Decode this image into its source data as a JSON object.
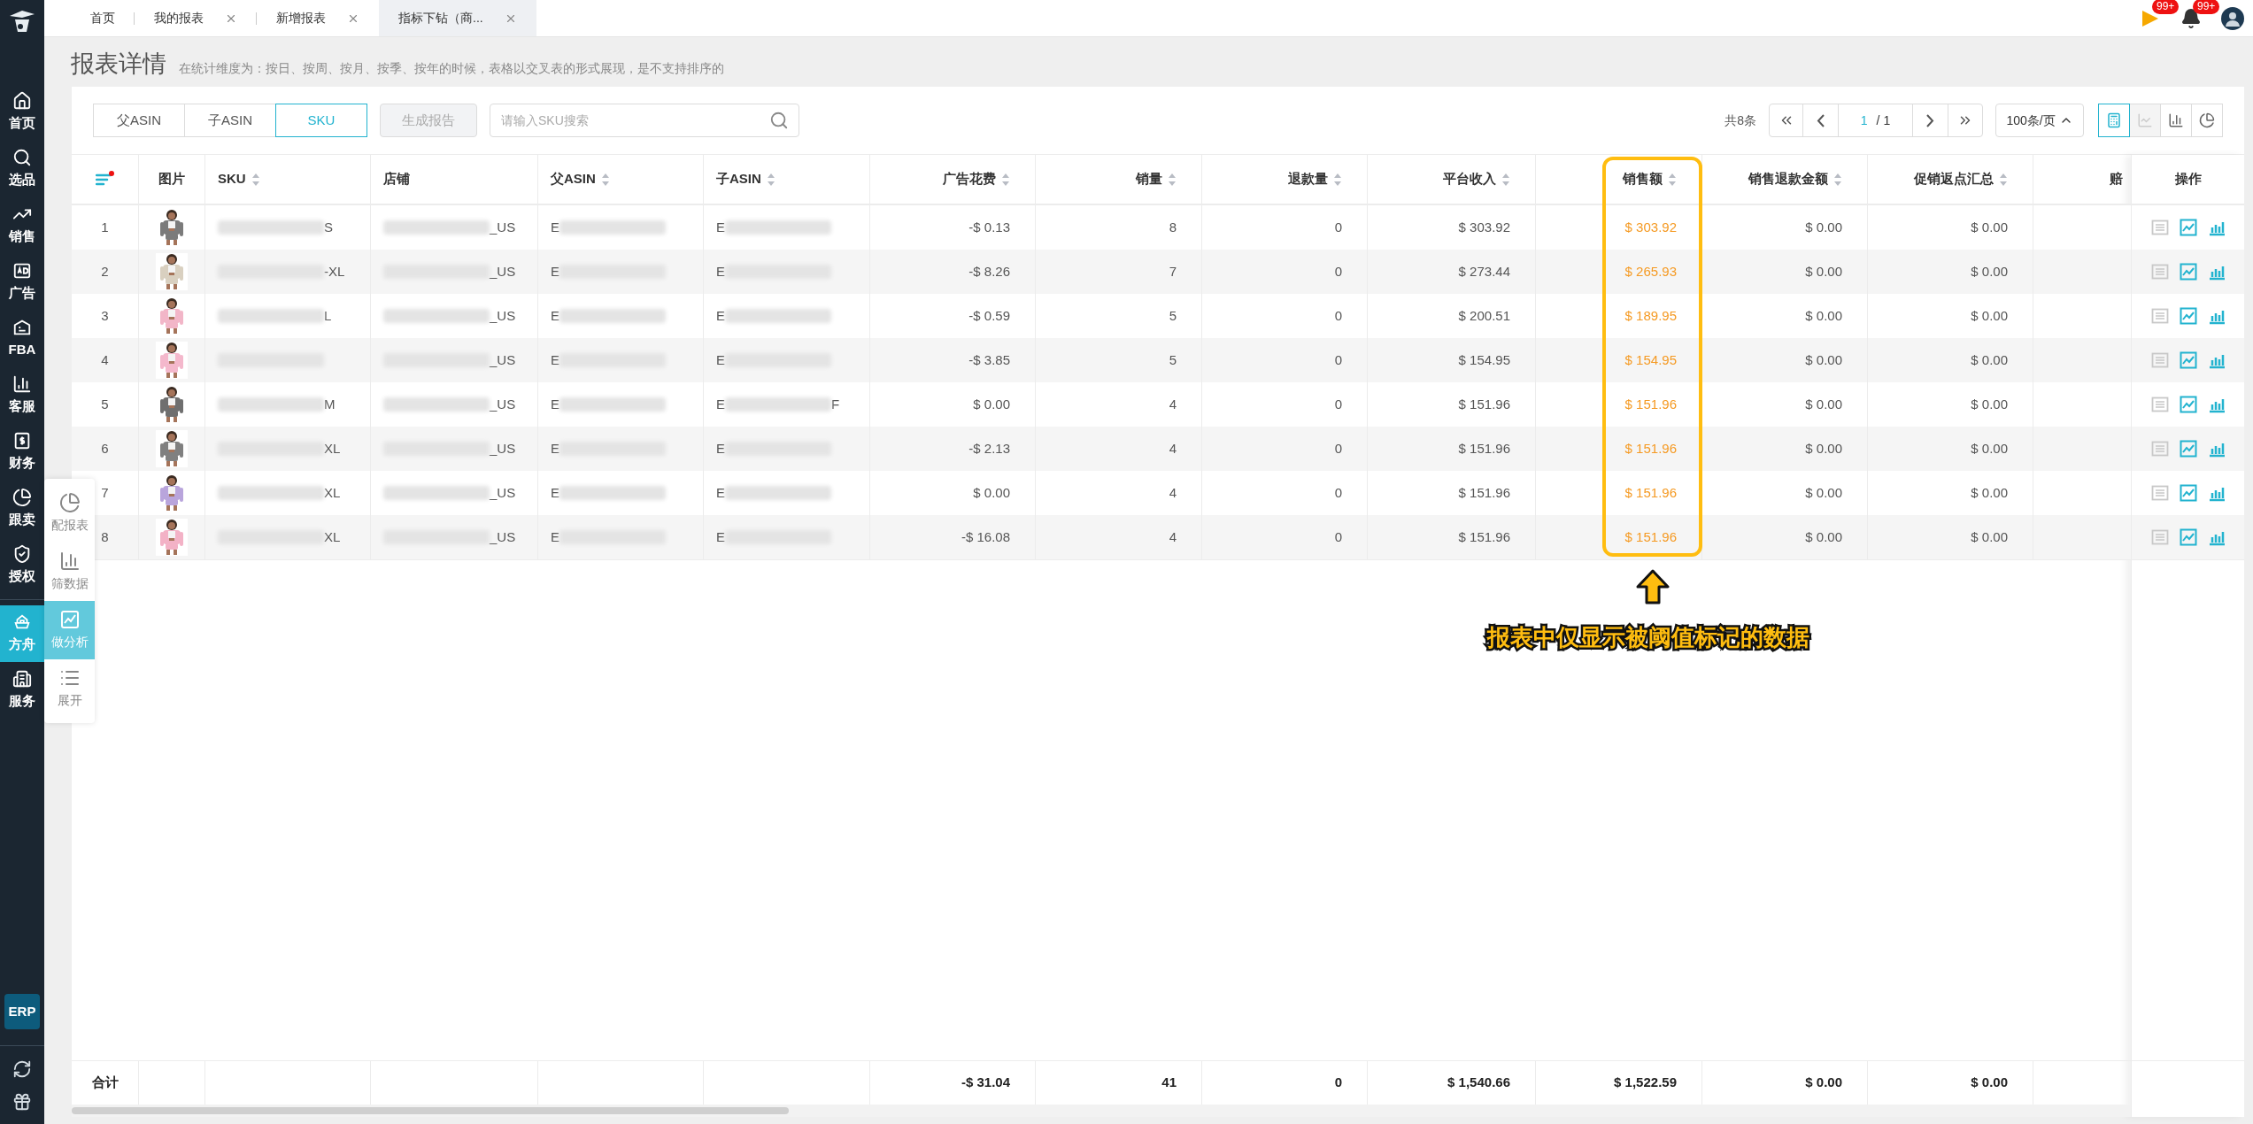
{
  "sidebar": {
    "items": [
      {
        "label": "首页",
        "kind": "home",
        "selected": false
      },
      {
        "label": "选品",
        "kind": "search",
        "selected": false
      },
      {
        "label": "销售",
        "kind": "trend",
        "selected": false
      },
      {
        "label": "广告",
        "kind": "ad",
        "selected": false
      },
      {
        "label": "FBA",
        "kind": "fba",
        "selected": false
      },
      {
        "label": "客服",
        "kind": "chart",
        "selected": false
      },
      {
        "label": "财务",
        "kind": "dollar",
        "selected": false
      },
      {
        "label": "跟卖",
        "kind": "pie",
        "selected": false
      },
      {
        "label": "授权",
        "kind": "shield",
        "selected": false
      },
      {
        "label": "方舟",
        "kind": "ark",
        "selected": true
      },
      {
        "label": "服务",
        "kind": "building",
        "selected": false
      }
    ],
    "erp_button": "ERP"
  },
  "float_menu": [
    {
      "label": "配报表",
      "kind": "pie",
      "selected": false
    },
    {
      "label": "筛数据",
      "kind": "chart",
      "selected": false
    },
    {
      "label": "做分析",
      "kind": "analysis",
      "selected": true
    },
    {
      "label": "展开",
      "kind": "list",
      "selected": false
    }
  ],
  "tabs": [
    {
      "label": "首页",
      "closable": false,
      "selected": false
    },
    {
      "label": "我的报表",
      "closable": true,
      "selected": false
    },
    {
      "label": "新增报表",
      "closable": true,
      "selected": false
    },
    {
      "label": "指标下钻（商...",
      "closable": true,
      "selected": true
    }
  ],
  "header_badges": [
    {
      "kind": "flag",
      "count": "99+"
    },
    {
      "kind": "bell",
      "count": "99+"
    }
  ],
  "page_title": "报表详情",
  "page_hint": "在统计维度为：按日、按周、按月、按季、按年的时候，表格以交叉表的形式展现，是不支持排序的",
  "dimension_tabs": [
    {
      "label": "父ASIN",
      "selected": false
    },
    {
      "label": "子ASIN",
      "selected": false
    },
    {
      "label": "SKU",
      "selected": true
    }
  ],
  "generate_button": "生成报告",
  "search": {
    "placeholder": "请输入SKU搜索"
  },
  "pagination": {
    "total": "共8条",
    "page": "1",
    "pages": "/ 1",
    "page_size": "100条/页"
  },
  "view_buttons": [
    {
      "kind": "table",
      "selected": true,
      "disabled": false
    },
    {
      "kind": "line",
      "selected": false,
      "disabled": true
    },
    {
      "kind": "bar",
      "selected": false,
      "disabled": false
    },
    {
      "kind": "pie",
      "selected": false,
      "disabled": false
    }
  ],
  "table": {
    "columns": [
      {
        "label": "图片",
        "kind": "text",
        "sortable": false
      },
      {
        "label": "SKU",
        "kind": "text",
        "sortable": true
      },
      {
        "label": "店铺",
        "kind": "text",
        "sortable": false
      },
      {
        "label": "父ASIN",
        "kind": "text",
        "sortable": true
      },
      {
        "label": "子ASIN",
        "kind": "text",
        "sortable": true
      },
      {
        "label": "广告花费",
        "kind": "number",
        "sortable": true
      },
      {
        "label": "销量",
        "kind": "number",
        "sortable": true
      },
      {
        "label": "退款量",
        "kind": "number",
        "sortable": true
      },
      {
        "label": "平台收入",
        "kind": "number",
        "sortable": true
      },
      {
        "label": "销售额",
        "kind": "number",
        "sortable": true,
        "highlighted": true
      },
      {
        "label": "销售退款金额",
        "kind": "number",
        "sortable": true
      },
      {
        "label": "促销返点汇总",
        "kind": "number",
        "sortable": true
      },
      {
        "label": "赔",
        "kind": "number",
        "sortable": false
      }
    ],
    "filter_dot": true,
    "actions_header": "操作",
    "rows": [
      {
        "no": "1",
        "cells": [
          {
            "kind": "picture"
          },
          {
            "tail": "S"
          },
          {
            "tail": "_US"
          },
          {
            "head": "E"
          },
          {
            "head": "E"
          },
          "-$ 0.13",
          "8",
          "0",
          "$ 303.92",
          "$ 303.92",
          "$ 0.00",
          "$ 0.00"
        ]
      },
      {
        "no": "2",
        "cells": [
          {
            "kind": "picture"
          },
          {
            "tail": "-XL"
          },
          {
            "tail": "_US"
          },
          {
            "head": "E"
          },
          {
            "head": "E"
          },
          "-$ 8.26",
          "7",
          "0",
          "$ 273.44",
          "$ 265.93",
          "$ 0.00",
          "$ 0.00"
        ]
      },
      {
        "no": "3",
        "cells": [
          {
            "kind": "picture"
          },
          {
            "tail": "L"
          },
          {
            "tail": "_US"
          },
          {
            "head": "E"
          },
          {
            "head": "E"
          },
          "-$ 0.59",
          "5",
          "0",
          "$ 200.51",
          "$ 189.95",
          "$ 0.00",
          "$ 0.00"
        ]
      },
      {
        "no": "4",
        "cells": [
          {
            "kind": "picture"
          },
          {},
          {
            "tail": "_US"
          },
          {
            "head": "E"
          },
          {
            "head": "E"
          },
          "-$ 3.85",
          "5",
          "0",
          "$ 154.95",
          "$ 154.95",
          "$ 0.00",
          "$ 0.00"
        ]
      },
      {
        "no": "5",
        "cells": [
          {
            "kind": "picture"
          },
          {
            "tail": "M"
          },
          {
            "tail": "_US"
          },
          {
            "head": "E"
          },
          {
            "head": "E",
            "tail": "F"
          },
          "$ 0.00",
          "4",
          "0",
          "$ 151.96",
          "$ 151.96",
          "$ 0.00",
          "$ 0.00"
        ]
      },
      {
        "no": "6",
        "cells": [
          {
            "kind": "picture"
          },
          {
            "tail": "XL"
          },
          {
            "tail": "_US"
          },
          {
            "head": "E"
          },
          {
            "head": "E"
          },
          "-$ 2.13",
          "4",
          "0",
          "$ 151.96",
          "$ 151.96",
          "$ 0.00",
          "$ 0.00"
        ]
      },
      {
        "no": "7",
        "cells": [
          {
            "kind": "picture"
          },
          {
            "tail": "XL"
          },
          {
            "tail": "_US"
          },
          {
            "head": "E"
          },
          {
            "head": "E"
          },
          "$ 0.00",
          "4",
          "0",
          "$ 151.96",
          "$ 151.96",
          "$ 0.00",
          "$ 0.00"
        ]
      },
      {
        "no": "8",
        "cells": [
          {
            "kind": "picture"
          },
          {
            "tail": "XL"
          },
          {
            "tail": "_US"
          },
          {
            "head": "E"
          },
          {
            "head": "E"
          },
          "-$ 16.08",
          "4",
          "0",
          "$ 151.96",
          "$ 151.96",
          "$ 0.00",
          "$ 0.00"
        ]
      }
    ],
    "footer": {
      "label": "合计",
      "cells": [
        "",
        "",
        "",
        "",
        "",
        "-$ 31.04",
        "41",
        "0",
        "$ 1,540.66",
        "$ 1,522.59",
        "$ 0.00",
        "$ 0.00"
      ]
    }
  },
  "annotation": {
    "text": "报表中仅显示被阈值标记的数据"
  }
}
